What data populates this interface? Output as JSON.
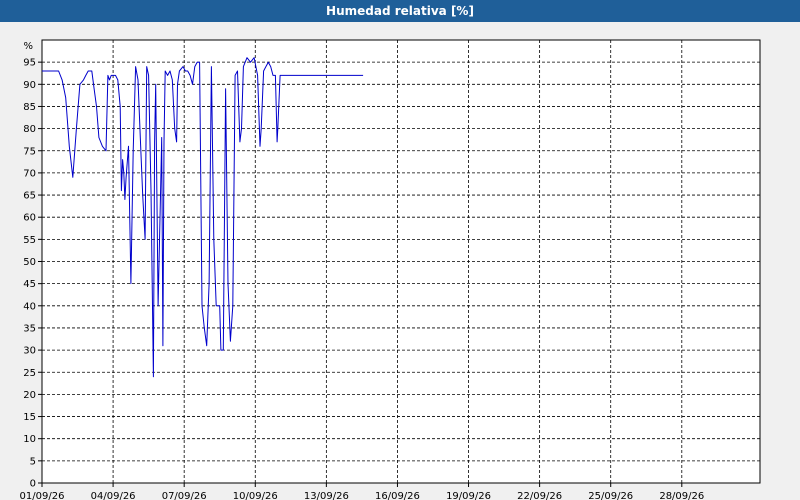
{
  "window": {
    "title": "Humedad relativa [%]"
  },
  "colors": {
    "title_bar": "#1f5f99",
    "series_line": "#0000cc",
    "grid": "#000000",
    "plot_background": "#ffffff",
    "frame_background": "#f0f0f0"
  },
  "chart_data": {
    "type": "line",
    "title": "Humedad relativa [%]",
    "ylabel": "%",
    "xlabel": "",
    "ylim": [
      0,
      100
    ],
    "yticks": [
      0,
      5,
      10,
      15,
      20,
      25,
      30,
      35,
      40,
      45,
      50,
      55,
      60,
      65,
      70,
      75,
      80,
      85,
      90,
      95
    ],
    "xlim_days": [
      0,
      30.3
    ],
    "xticks": [
      "01/09/26",
      "04/09/26",
      "07/09/26",
      "10/09/26",
      "13/09/26",
      "16/09/26",
      "19/09/26",
      "22/09/26",
      "25/09/26",
      "28/09/26"
    ],
    "grid": true,
    "legend": "none",
    "series": [
      {
        "x_days": [
          0.0,
          0.15,
          0.3,
          0.4,
          0.5,
          0.6,
          0.7,
          0.85,
          1.0,
          1.15,
          1.3,
          1.45,
          1.6,
          1.75,
          1.85,
          1.95,
          2.05,
          2.1,
          2.2,
          2.3,
          2.4,
          2.55,
          2.7,
          2.78,
          2.85,
          2.92,
          3.0,
          3.1,
          3.2,
          3.3,
          3.35,
          3.4,
          3.45,
          3.5,
          3.55,
          3.65,
          3.75,
          3.85,
          3.95,
          4.05,
          4.15,
          4.25,
          4.35,
          4.42,
          4.5,
          4.6,
          4.7,
          4.75,
          4.8,
          4.9,
          5.0,
          5.05,
          5.1,
          5.15,
          5.2,
          5.3,
          5.4,
          5.5,
          5.6,
          5.68,
          5.72,
          5.8,
          5.95,
          6.05,
          6.15,
          6.25,
          6.35,
          6.45,
          6.55,
          6.65,
          6.75,
          6.85,
          6.95,
          7.05,
          7.15,
          7.25,
          7.35,
          7.45,
          7.5,
          7.55,
          7.65,
          7.75,
          7.85,
          7.95,
          8.05,
          8.15,
          8.25,
          8.35,
          8.42,
          8.5,
          8.65,
          8.8,
          8.95,
          9.1,
          9.2,
          9.25,
          9.35,
          9.45,
          9.55,
          9.65,
          9.75,
          9.85,
          9.92,
          9.95,
          10.05,
          10.15,
          10.25,
          10.35,
          10.45,
          10.55,
          10.65,
          10.75,
          10.85,
          10.95,
          11.05,
          11.15,
          11.25,
          11.35,
          11.5,
          11.65,
          11.75,
          11.8,
          11.95,
          12.05,
          12.15,
          12.25,
          12.35,
          12.45,
          12.55,
          12.65,
          12.75,
          12.85,
          12.95,
          13.05,
          13.15,
          13.25,
          13.35,
          13.45,
          13.55
        ],
        "values": [
          93,
          93,
          93,
          93,
          93,
          93,
          93,
          91,
          87,
          76,
          69,
          80,
          90,
          91,
          92,
          93,
          93,
          93,
          89,
          85,
          78,
          76,
          75,
          92,
          91,
          92,
          92,
          92,
          91,
          85,
          66,
          73,
          70,
          64,
          69,
          76,
          45,
          75,
          94,
          91,
          78,
          65,
          55,
          94,
          92,
          66,
          24,
          77,
          90,
          40,
          65,
          78,
          31,
          77,
          93,
          92,
          93,
          91,
          80,
          77,
          90,
          93,
          94,
          93,
          93,
          92,
          90,
          94,
          95,
          95,
          40,
          35,
          31,
          45,
          94,
          55,
          40,
          40,
          40,
          30,
          30,
          89,
          45,
          32,
          40,
          92,
          93,
          77,
          80,
          94,
          96,
          95,
          96,
          92,
          76,
          80,
          93,
          94,
          95,
          94,
          92,
          92,
          77,
          80,
          92,
          92,
          92,
          92,
          92,
          92,
          92,
          92,
          92,
          92,
          92,
          92,
          92,
          92,
          92,
          92,
          92,
          92,
          92,
          92,
          92,
          92,
          92,
          92,
          92,
          92,
          92,
          92,
          92,
          92,
          92,
          92,
          92,
          92,
          92,
          92
        ]
      }
    ]
  }
}
